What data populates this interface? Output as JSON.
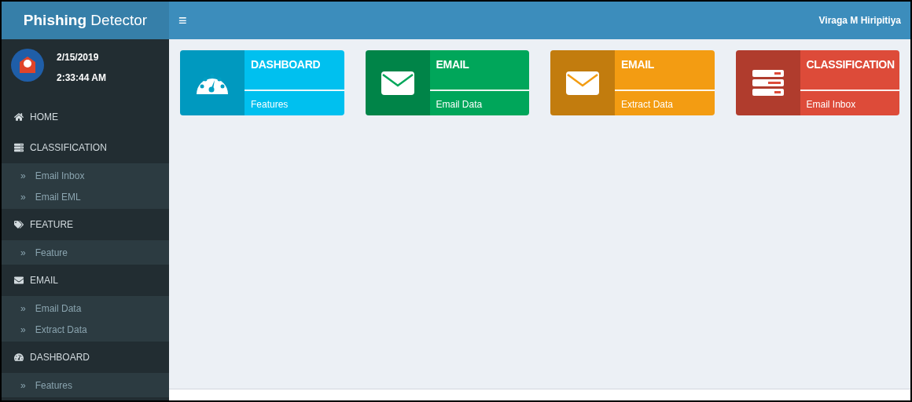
{
  "brand": {
    "title": "**Phishing** Detector"
  },
  "header": {
    "menu_toggle": "≡",
    "user_name": "Viraga M Hiripitiya"
  },
  "user_panel": {
    "date": "2/15/2019",
    "time": "2:33:44 AM"
  },
  "sidebar": {
    "sections": [
      {
        "label": "HOME"
      },
      {
        "label": "CLASSIFICATION",
        "children": [
          {
            "label": "Email Inbox",
            "marker": "»"
          },
          {
            "label": "Email EML",
            "marker": "»"
          }
        ]
      },
      {
        "label": "FEATURE",
        "children": [
          {
            "label": "Feature",
            "marker": "»"
          }
        ]
      },
      {
        "label": "EMAIL",
        "children": [
          {
            "label": "Email Data",
            "marker": "»"
          },
          {
            "label": "Extract Data",
            "marker": "»"
          }
        ]
      },
      {
        "label": "DASHBOARD",
        "children": [
          {
            "label": "Features",
            "marker": "»"
          }
        ]
      }
    ]
  },
  "tiles": [
    {
      "title": "DASHBOARD",
      "subtitle": "Features",
      "color": "#00c0ef"
    },
    {
      "title": "EMAIL",
      "subtitle": "Email Data",
      "color": "#00a65a"
    },
    {
      "title": "EMAIL",
      "subtitle": "Extract Data",
      "color": "#f39c12"
    },
    {
      "title": "CLASSIFICATION",
      "subtitle": "Email Inbox",
      "color": "#dd4b39"
    }
  ]
}
